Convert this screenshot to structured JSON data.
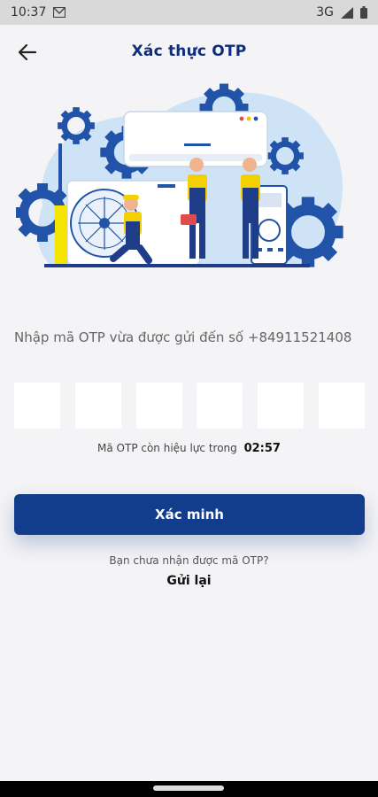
{
  "status_bar": {
    "time": "10:37",
    "network": "3G"
  },
  "header": {
    "title": "Xác thực OTP",
    "back_icon": "arrow-left-icon"
  },
  "hero": {
    "illustration": "technicians-air-conditioner-illustration"
  },
  "otp": {
    "instruction": "Nhập mã OTP vừa được gửi đến số +84911521408",
    "digits": [
      "",
      "",
      "",
      "",
      "",
      ""
    ],
    "validity_label": "Mã OTP còn hiệu lực trong",
    "countdown": "02:57"
  },
  "actions": {
    "verify_label": "Xác minh",
    "resend_prompt": "Bạn chưa nhận được mã OTP?",
    "resend_label": "Gửi lại"
  },
  "colors": {
    "primary": "#123c8c",
    "title": "#0f2d7a",
    "background": "#f4f4f6"
  }
}
